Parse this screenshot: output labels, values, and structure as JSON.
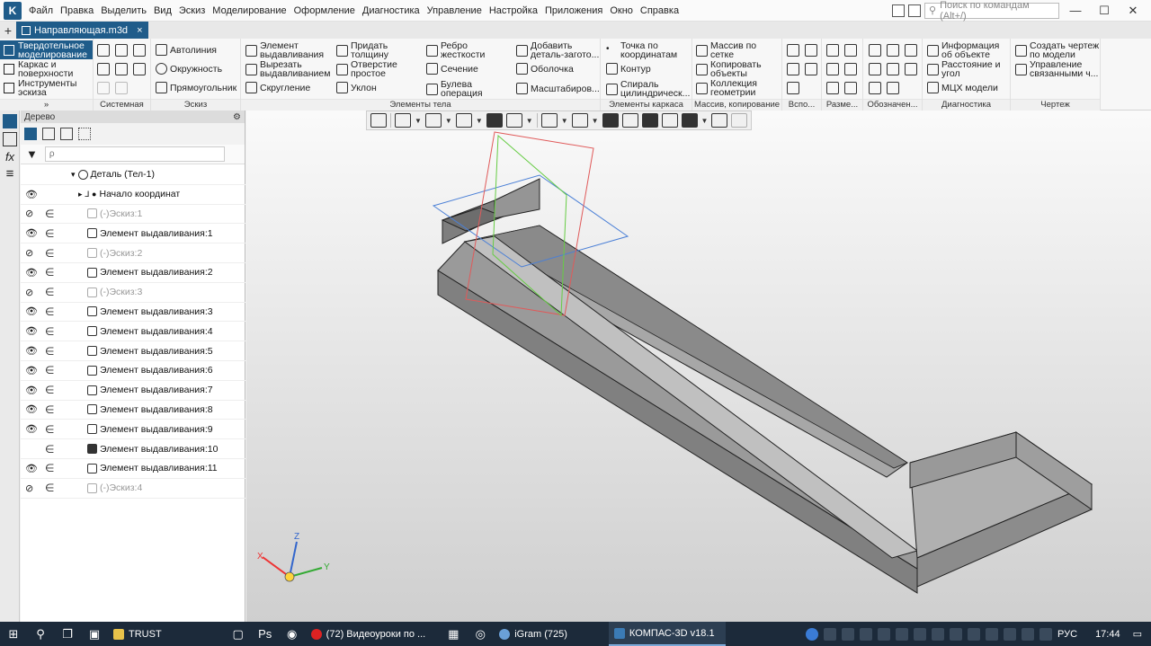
{
  "menu": {
    "items": [
      "Файл",
      "Правка",
      "Выделить",
      "Вид",
      "Эскиз",
      "Моделирование",
      "Оформление",
      "Диагностика",
      "Управление",
      "Настройка",
      "Приложения",
      "Окно",
      "Справка"
    ],
    "search_placeholder": "Поиск по командам (Alt+/)"
  },
  "window_controls": {
    "minimize": "—",
    "maximize": "☐",
    "close": "✕"
  },
  "tabs": {
    "add": "+",
    "doc_name": "Направляющая.m3d",
    "close": "×"
  },
  "ribbon": {
    "modes": [
      "Твердотельное\nмоделирование",
      "Каркас и\nповерхности",
      "Инструменты\nэскиза"
    ],
    "sketch": {
      "autoline": "Автолиния",
      "circle": "Окружность",
      "rect": "Прямоугольник"
    },
    "body": {
      "extrude": "Элемент\nвыдавливания",
      "cut_extrude": "Вырезать\nвыдавливанием",
      "fillet": "Скругление",
      "thicken": "Придать\nтолщину",
      "hole": "Отверстие\nпростое",
      "draft": "Уклон",
      "rib": "Ребро\nжесткости",
      "section": "Сечение",
      "boolean": "Булева\nоперация",
      "add_part": "Добавить\nдеталь-загото...",
      "shell": "Оболочка",
      "scale": "Масштабиров..."
    },
    "wire": {
      "point": "Точка по\nкоординатам",
      "contour": "Контур",
      "spiral": "Спираль\nцилиндрическ..."
    },
    "array": {
      "mesh": "Массив по\nсетке",
      "copy": "Копировать\nобъекты",
      "collection": "Коллекция\nгеометрии"
    },
    "diag": {
      "info": "Информация\nоб объекте",
      "distance": "Расстояние и\nугол",
      "mass": "МЦХ модели"
    },
    "drawing": {
      "create": "Создать чертеж\nпо модели",
      "manage": "Управление\nсвязанными ч..."
    },
    "group_labels": {
      "system": "Системная",
      "sketch": "Эскиз",
      "body": "Элементы тела",
      "wire": "Элементы каркаса",
      "array": "Массив, копирование",
      "aux": "Вспо...",
      "dims": "Разме...",
      "notation": "Обозначен...",
      "diag": "Диагностика",
      "drawing": "Чертеж"
    }
  },
  "tree": {
    "title": "Дерево",
    "filter_placeholder": "ρ",
    "rows": [
      {
        "label": "Деталь (Тел-1)",
        "eye": "",
        "inc": "",
        "dim": false,
        "indent": 0,
        "kind": "part"
      },
      {
        "label": "Начало координат",
        "eye": "👁",
        "inc": "",
        "dim": false,
        "indent": 1,
        "kind": "origin"
      },
      {
        "label": "(-)Эскиз:1",
        "eye": "⊘",
        "inc": "∈",
        "dim": true,
        "indent": 2,
        "kind": "sketch"
      },
      {
        "label": "Элемент выдавливания:1",
        "eye": "👁",
        "inc": "∈",
        "dim": false,
        "indent": 2,
        "kind": "op"
      },
      {
        "label": "(-)Эскиз:2",
        "eye": "⊘",
        "inc": "∈",
        "dim": true,
        "indent": 2,
        "kind": "sketch"
      },
      {
        "label": "Элемент выдавливания:2",
        "eye": "👁",
        "inc": "∈",
        "dim": false,
        "indent": 2,
        "kind": "op"
      },
      {
        "label": "(-)Эскиз:3",
        "eye": "⊘",
        "inc": "∈",
        "dim": true,
        "indent": 2,
        "kind": "sketch"
      },
      {
        "label": "Элемент выдавливания:3",
        "eye": "👁",
        "inc": "∈",
        "dim": false,
        "indent": 2,
        "kind": "op"
      },
      {
        "label": "Элемент выдавливания:4",
        "eye": "👁",
        "inc": "∈",
        "dim": false,
        "indent": 2,
        "kind": "op"
      },
      {
        "label": "Элемент выдавливания:5",
        "eye": "👁",
        "inc": "∈",
        "dim": false,
        "indent": 2,
        "kind": "op"
      },
      {
        "label": "Элемент выдавливания:6",
        "eye": "👁",
        "inc": "∈",
        "dim": false,
        "indent": 2,
        "kind": "op"
      },
      {
        "label": "Элемент выдавливания:7",
        "eye": "👁",
        "inc": "∈",
        "dim": false,
        "indent": 2,
        "kind": "op"
      },
      {
        "label": "Элемент выдавливания:8",
        "eye": "👁",
        "inc": "∈",
        "dim": false,
        "indent": 2,
        "kind": "op"
      },
      {
        "label": "Элемент выдавливания:9",
        "eye": "👁",
        "inc": "∈",
        "dim": false,
        "indent": 2,
        "kind": "op"
      },
      {
        "label": "Элемент выдавливания:10",
        "eye": "",
        "inc": "∈",
        "dim": false,
        "indent": 2,
        "kind": "op-filled"
      },
      {
        "label": "Элемент выдавливания:11",
        "eye": "👁",
        "inc": "∈",
        "dim": false,
        "indent": 2,
        "kind": "op"
      },
      {
        "label": "(-)Эскиз:4",
        "eye": "⊘",
        "inc": "∈",
        "dim": true,
        "indent": 2,
        "kind": "sketch"
      }
    ]
  },
  "axes": {
    "x": "X",
    "y": "Y",
    "z": "Z"
  },
  "taskbar": {
    "apps": [
      "TRUST",
      "(72) Видеоуроки по ...",
      "iGram (725)",
      "КОМПАС-3D v18.1"
    ],
    "lang": "РУС",
    "time": "17:44"
  }
}
